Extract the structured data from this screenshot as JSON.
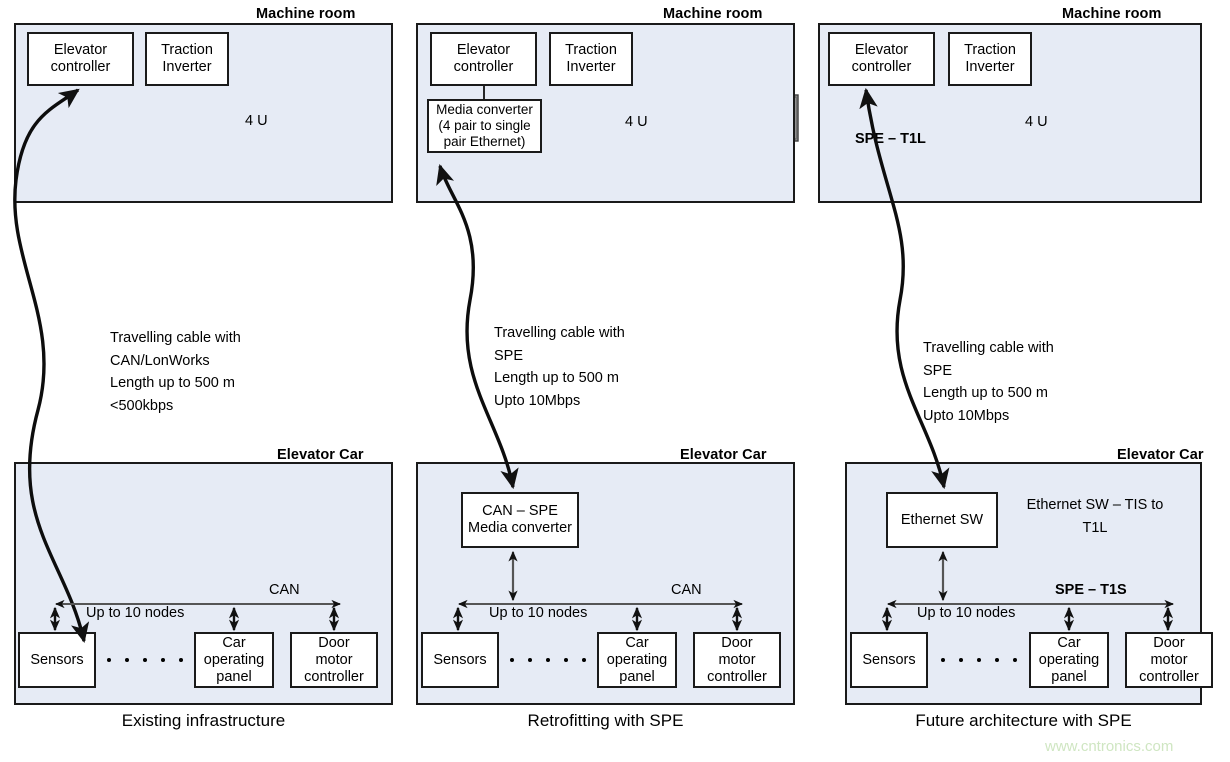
{
  "figure": {
    "watermark": "www.cntronics.com"
  },
  "columns": [
    {
      "id": "existing",
      "caption": "Existing infrastructure",
      "machine_room": {
        "title": "Machine room",
        "boxes": [
          {
            "name": "elevator-controller",
            "label": "Elevator\ncontroller"
          },
          {
            "name": "traction-inverter",
            "label": "Traction\nInverter"
          }
        ],
        "rack_label": "4 U",
        "protocol_label": "",
        "icons": [
          "battery-bank-icon",
          "ups-rack-icon",
          "motor-icon",
          "pulley-icon"
        ]
      },
      "cable": {
        "label": "Travelling cable with\nCAN/LonWorks\nLength up to 500 m\n<500kbps"
      },
      "elevator_car": {
        "title": "Elevator Car",
        "converter": null,
        "converter_note": "",
        "bus_label": "CAN",
        "bus_label_bold": false,
        "nodes_label": "Up to 10 nodes",
        "nodes": [
          {
            "name": "sensors",
            "label": "Sensors"
          },
          {
            "name": "car-operating-panel",
            "label": "Car\noperating\npanel"
          },
          {
            "name": "door-motor-controller",
            "label": "Door\nmotor\ncontroller"
          }
        ]
      }
    },
    {
      "id": "retrofit",
      "caption": "Retrofitting with SPE",
      "machine_room": {
        "title": "Machine room",
        "boxes": [
          {
            "name": "elevator-controller",
            "label": "Elevator\ncontroller"
          },
          {
            "name": "traction-inverter",
            "label": "Traction\nInverter"
          }
        ],
        "rack_label": "4 U",
        "protocol_label": "",
        "media_converter": "Media converter\n(4 pair to single\npair Ethernet)",
        "icons": [
          "battery-bank-icon",
          "ups-rack-icon",
          "motor-icon",
          "pulley-icon"
        ]
      },
      "cable": {
        "label": "Travelling cable with\nSPE\nLength up to 500 m\nUpto 10Mbps"
      },
      "elevator_car": {
        "title": "Elevator Car",
        "converter": "CAN – SPE\nMedia converter",
        "converter_note": "",
        "bus_label": "CAN",
        "bus_label_bold": false,
        "nodes_label": "Up to 10 nodes",
        "nodes": [
          {
            "name": "sensors",
            "label": "Sensors"
          },
          {
            "name": "car-operating-panel",
            "label": "Car\noperating\npanel"
          },
          {
            "name": "door-motor-controller",
            "label": "Door\nmotor\ncontroller"
          }
        ]
      }
    },
    {
      "id": "future",
      "caption": "Future architecture with SPE",
      "machine_room": {
        "title": "Machine room",
        "boxes": [
          {
            "name": "elevator-controller",
            "label": "Elevator\ncontroller"
          },
          {
            "name": "traction-inverter",
            "label": "Traction\nInverter"
          }
        ],
        "rack_label": "4 U",
        "protocol_label": "SPE – T1L",
        "icons": [
          "battery-bank-icon",
          "ups-rack-icon",
          "motor-icon",
          "pulley-icon"
        ]
      },
      "cable": {
        "label": "Travelling cable with\nSPE\nLength up to 500 m\nUpto 10Mbps"
      },
      "elevator_car": {
        "title": "Elevator Car",
        "converter": "Ethernet SW",
        "converter_note": "Ethernet SW – TIS to\nT1L",
        "bus_label": "SPE – T1S",
        "bus_label_bold": true,
        "nodes_label": "Up to 10 nodes",
        "nodes": [
          {
            "name": "sensors",
            "label": "Sensors"
          },
          {
            "name": "car-operating-panel",
            "label": "Car\noperating\npanel"
          },
          {
            "name": "door-motor-controller",
            "label": "Door\nmotor\ncontroller"
          }
        ]
      }
    }
  ]
}
